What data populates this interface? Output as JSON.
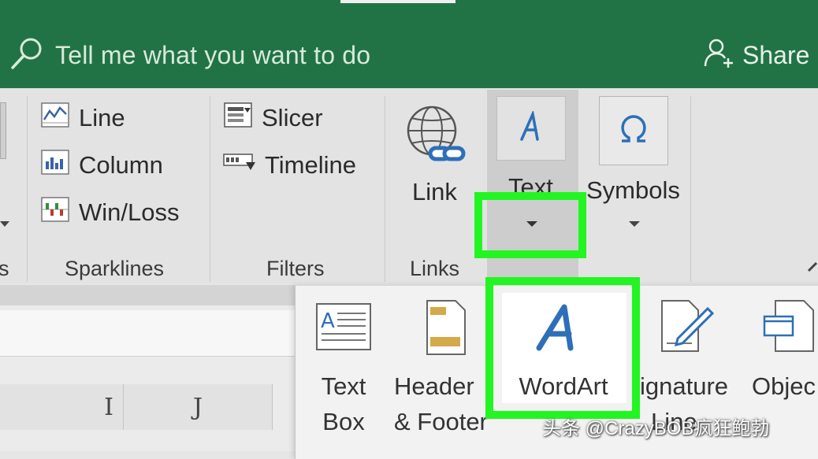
{
  "tellme": {
    "placeholder": "Tell me what you want to do"
  },
  "share": {
    "label": "Share"
  },
  "sparklines": {
    "items": [
      "Line",
      "Column",
      "Win/Loss"
    ],
    "group_label": "Sparklines"
  },
  "filters": {
    "items": [
      "Slicer",
      "Timeline"
    ],
    "group_label": "Filters"
  },
  "links": {
    "link_label": "Link",
    "group_label": "Links"
  },
  "text_group": {
    "label": "Text"
  },
  "symbols": {
    "label": "Symbols"
  },
  "truncated_group_label": "s",
  "columns": [
    "I",
    "J"
  ],
  "text_menu": {
    "text_box": [
      "Text",
      "Box"
    ],
    "header_footer": [
      "Header",
      "& Footer"
    ],
    "wordart": "WordArt",
    "signature": [
      "ignature",
      "Line"
    ],
    "object": "Objec"
  },
  "watermark": "头条 @CrazyBOB疯狂鲍勃",
  "colors": {
    "titlebar": "#217346",
    "highlight": "#22f522",
    "icon_blue": "#2e6fb7"
  }
}
